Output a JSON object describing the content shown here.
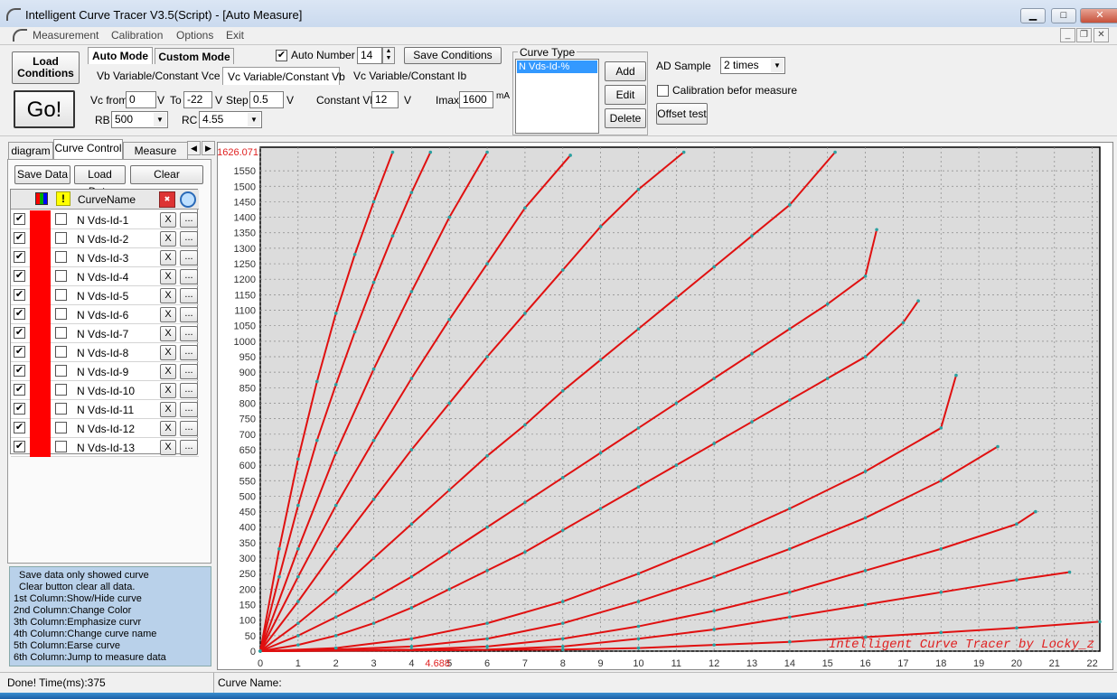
{
  "window": {
    "title": "Intelligent Curve Tracer V3.5(Script) - [Auto Measure]",
    "controls": [
      "▁",
      "□",
      "✕"
    ]
  },
  "menu": {
    "items": [
      "Measurement",
      "Calibration",
      "Options",
      "Exit"
    ],
    "mdi_controls": [
      "_",
      "❐",
      "✕"
    ]
  },
  "toolbar": {
    "load_conditions": "Load\nConditions",
    "go": "Go!",
    "mode_tabs": [
      "Auto Mode",
      "Custom Mode"
    ],
    "sweep_tabs": [
      "Vb Variable/Constant Vce",
      "Vc Variable/Constant Vb",
      "Vc Variable/Constant Ib"
    ],
    "auto_number_label": "Auto Number",
    "auto_number_checked": true,
    "auto_number_value": "14",
    "save_conditions": "Save Conditions",
    "vc_from_label": "Vc from",
    "vc_from_value": "0",
    "v_unit": "V",
    "to_label": "To",
    "to_value": "-22",
    "step_label": "Step",
    "step_value": "0.5",
    "constant_vb_label": "Constant Vb",
    "constant_vb_value": "12",
    "imax_label": "Imax",
    "imax_value": "1600",
    "imax_unit": "mA",
    "rb_label": "RB",
    "rb_value": "500",
    "rc_label": "RC",
    "rc_value": "4.55",
    "curve_type_label": "Curve Type",
    "curve_type_items": [
      "N Vds-Id-%"
    ],
    "add": "Add",
    "edit": "Edit",
    "delete": "Delete",
    "ad_sample_label": "AD Sample",
    "ad_sample_value": "2 times",
    "calibration_label": "Calibration befor measure",
    "calibration_checked": false,
    "offset_test": "Offset test"
  },
  "left_panel": {
    "tabs": [
      "diagram",
      "Curve Control",
      "Measure Data"
    ],
    "save_data": "Save Data",
    "load_data": "Load Data",
    "clear": "Clear",
    "column_name": "CurveName",
    "row_color": "#ff0000",
    "curves": [
      "N Vds-Id-1",
      "N Vds-Id-2",
      "N Vds-Id-3",
      "N Vds-Id-4",
      "N Vds-Id-5",
      "N Vds-Id-6",
      "N Vds-Id-7",
      "N Vds-Id-8",
      "N Vds-Id-9",
      "N Vds-Id-10",
      "N Vds-Id-11",
      "N Vds-Id-12",
      "N Vds-Id-13"
    ],
    "delete_label": "X",
    "more_label": "...",
    "info_lines": [
      "Save data only showed curve",
      "Clear button clear all data.",
      "1st Column:Show/Hide curve",
      "2nd Column:Change Color",
      "3th Column:Emphasize curvr",
      "4th Column:Change curve name",
      "5th Column:Earse curve",
      "6th Column:Jump to measure data"
    ]
  },
  "status": {
    "left": "Done!  Time(ms):375",
    "right": "Curve Name:"
  },
  "chart_data": {
    "type": "line",
    "xlim": [
      0,
      22.2
    ],
    "ylim": [
      0,
      1626.071
    ],
    "ymax_label": "1626.071",
    "x_ticks": [
      0,
      1,
      2,
      3,
      4,
      5,
      6,
      7,
      8,
      9,
      10,
      11,
      12,
      13,
      14,
      15,
      16,
      17,
      18,
      19,
      20,
      21,
      22
    ],
    "y_ticks": [
      0,
      50,
      100,
      150,
      200,
      250,
      300,
      350,
      400,
      450,
      500,
      550,
      600,
      650,
      700,
      750,
      800,
      850,
      900,
      950,
      1000,
      1050,
      1100,
      1150,
      1200,
      1250,
      1300,
      1350,
      1400,
      1450,
      1500,
      1550
    ],
    "cursor_x_label": "4.688",
    "watermark": "Intelligent Curve Tracer by Locky_z",
    "grid": true,
    "line_color": "#e01010",
    "marker_color": "#2aa0a0",
    "series": [
      {
        "x": [
          0,
          0.5,
          1,
          1.5,
          2,
          2.5,
          3,
          3.5
        ],
        "y": [
          0,
          330,
          620,
          870,
          1090,
          1280,
          1450,
          1610
        ]
      },
      {
        "x": [
          0,
          0.5,
          1,
          1.5,
          2,
          2.5,
          3,
          3.5,
          4,
          4.5
        ],
        "y": [
          0,
          240,
          470,
          680,
          860,
          1030,
          1190,
          1340,
          1480,
          1610
        ]
      },
      {
        "x": [
          0,
          1,
          2,
          3,
          4,
          5,
          6
        ],
        "y": [
          0,
          330,
          640,
          910,
          1160,
          1400,
          1610
        ]
      },
      {
        "x": [
          0,
          1,
          2,
          3,
          4,
          5,
          6,
          7,
          8.2
        ],
        "y": [
          0,
          240,
          470,
          680,
          880,
          1070,
          1250,
          1430,
          1600
        ]
      },
      {
        "x": [
          0,
          1,
          2,
          3,
          4,
          5,
          6,
          7,
          8,
          9,
          10,
          11.2
        ],
        "y": [
          0,
          160,
          330,
          490,
          650,
          800,
          950,
          1090,
          1230,
          1370,
          1490,
          1610
        ]
      },
      {
        "x": [
          0,
          1,
          2,
          3,
          4,
          5,
          6,
          7,
          8,
          9,
          10,
          11,
          12,
          13,
          14,
          15.2
        ],
        "y": [
          0,
          90,
          190,
          300,
          410,
          520,
          630,
          730,
          840,
          940,
          1040,
          1140,
          1240,
          1340,
          1440,
          1610
        ]
      },
      {
        "x": [
          0,
          1,
          2,
          3,
          4,
          5,
          6,
          7,
          8,
          9,
          10,
          11,
          12,
          13,
          14,
          15,
          16,
          16.3
        ],
        "y": [
          0,
          50,
          110,
          170,
          240,
          320,
          400,
          480,
          560,
          640,
          720,
          800,
          880,
          960,
          1040,
          1120,
          1210,
          1360
        ]
      },
      {
        "x": [
          0,
          1,
          2,
          3,
          4,
          5,
          6,
          7,
          8,
          9,
          10,
          11,
          12,
          13,
          14,
          15,
          16,
          17,
          17.4
        ],
        "y": [
          0,
          20,
          50,
          90,
          140,
          200,
          260,
          320,
          390,
          460,
          530,
          600,
          670,
          740,
          810,
          880,
          950,
          1060,
          1130
        ]
      },
      {
        "x": [
          0,
          2,
          4,
          6,
          8,
          10,
          12,
          14,
          16,
          18,
          18.4
        ],
        "y": [
          0,
          10,
          40,
          90,
          160,
          250,
          350,
          460,
          580,
          720,
          890
        ]
      },
      {
        "x": [
          0,
          2,
          4,
          6,
          8,
          10,
          12,
          14,
          16,
          18,
          19.5
        ],
        "y": [
          0,
          5,
          15,
          40,
          90,
          160,
          240,
          330,
          430,
          550,
          660
        ]
      },
      {
        "x": [
          0,
          4,
          6,
          8,
          10,
          12,
          14,
          16,
          18,
          20,
          20.5
        ],
        "y": [
          0,
          5,
          15,
          40,
          80,
          130,
          190,
          260,
          330,
          410,
          450
        ]
      },
      {
        "x": [
          0,
          6,
          8,
          10,
          12,
          14,
          16,
          18,
          20,
          21.4
        ],
        "y": [
          0,
          5,
          15,
          40,
          70,
          110,
          150,
          190,
          230,
          255
        ]
      },
      {
        "x": [
          0,
          8,
          10,
          12,
          14,
          16,
          18,
          20,
          22.2
        ],
        "y": [
          0,
          5,
          10,
          20,
          30,
          45,
          60,
          75,
          95
        ]
      }
    ]
  }
}
